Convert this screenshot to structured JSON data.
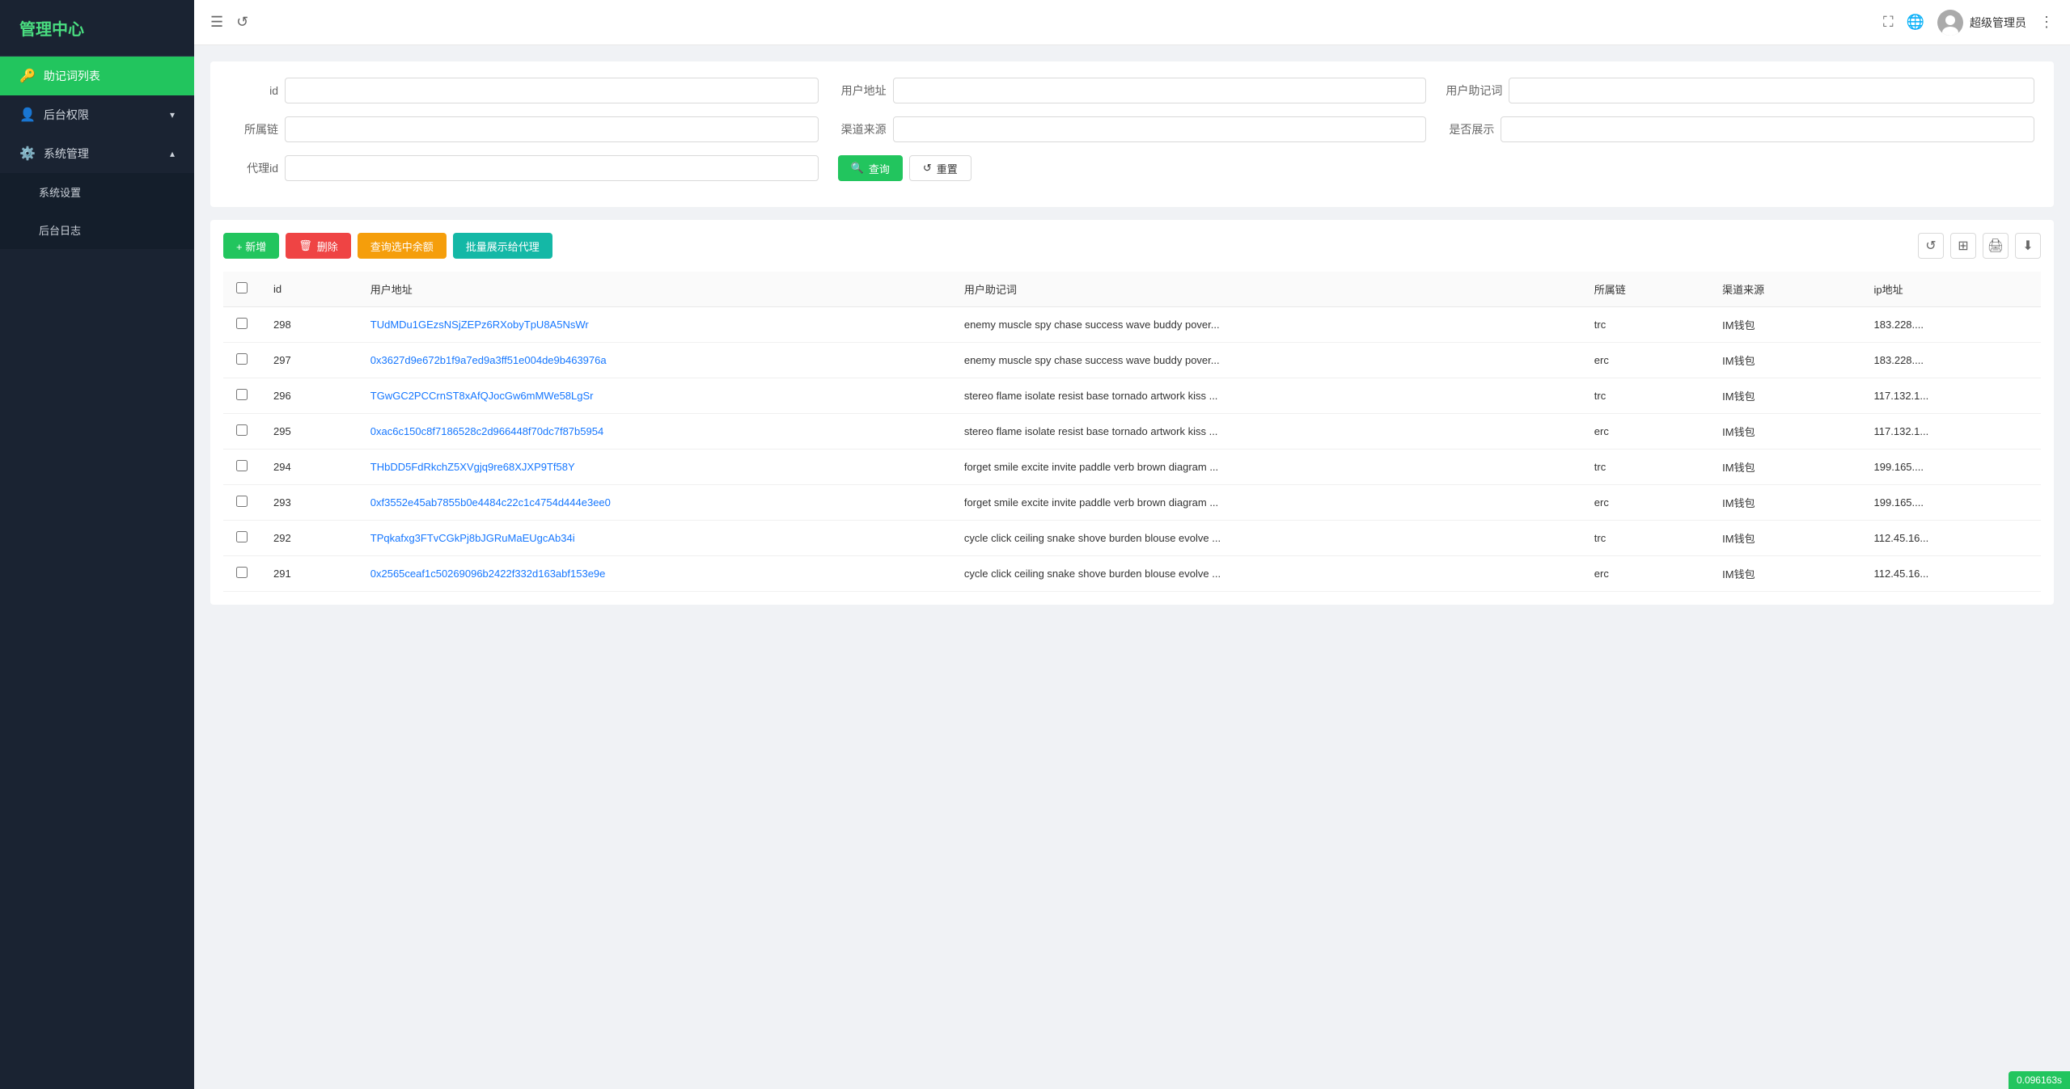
{
  "sidebar": {
    "logo": "管理中心",
    "items": [
      {
        "id": "mnemonic-list",
        "icon": "🔑",
        "label": "助记词列表",
        "active": true
      },
      {
        "id": "backend-permissions",
        "icon": "👤",
        "label": "后台权限",
        "hasArrow": true,
        "expanded": false
      },
      {
        "id": "system-management",
        "icon": "⚙️",
        "label": "系统管理",
        "hasArrow": true,
        "expanded": true
      }
    ],
    "submenu": [
      {
        "id": "system-settings",
        "label": "系统设置"
      },
      {
        "id": "backend-log",
        "label": "后台日志"
      }
    ]
  },
  "header": {
    "username": "超级管理员",
    "more_icon": "⋮"
  },
  "filter": {
    "fields": [
      {
        "id": "id",
        "label": "id",
        "placeholder": ""
      },
      {
        "id": "user-address",
        "label": "用户地址",
        "placeholder": ""
      },
      {
        "id": "user-mnemonic",
        "label": "用户助记词",
        "placeholder": ""
      },
      {
        "id": "chain",
        "label": "所属链",
        "placeholder": ""
      },
      {
        "id": "channel-source",
        "label": "渠道来源",
        "placeholder": ""
      },
      {
        "id": "show-status",
        "label": "是否展示",
        "placeholder": ""
      },
      {
        "id": "agent-id",
        "label": "代理id",
        "placeholder": ""
      }
    ],
    "search_btn": "查询",
    "reset_btn": "重置"
  },
  "toolbar": {
    "add_btn": "+ 新增",
    "delete_btn": "删除",
    "query_balance_btn": "查询选中余额",
    "batch_show_btn": "批量展示给代理"
  },
  "table": {
    "columns": [
      {
        "id": "checkbox",
        "label": ""
      },
      {
        "id": "id",
        "label": "id"
      },
      {
        "id": "user-address",
        "label": "用户地址"
      },
      {
        "id": "user-mnemonic",
        "label": "用户助记词"
      },
      {
        "id": "chain",
        "label": "所属链"
      },
      {
        "id": "channel-source",
        "label": "渠道来源"
      },
      {
        "id": "ip",
        "label": "ip地址"
      }
    ],
    "rows": [
      {
        "id": "298",
        "user_address": "TUdMDu1GEzsNSjZEPz6RXobyTpU8A5NsWr",
        "user_address_link": true,
        "user_mnemonic": "enemy muscle spy chase success wave buddy pover...",
        "chain": "trc",
        "channel": "IM钱包",
        "ip": "183.228...."
      },
      {
        "id": "297",
        "user_address": "0x3627d9e672b1f9a7ed9a3ff51e004de9b463976a",
        "user_address_link": true,
        "user_mnemonic": "enemy muscle spy chase success wave buddy pover...",
        "chain": "erc",
        "channel": "IM钱包",
        "ip": "183.228...."
      },
      {
        "id": "296",
        "user_address": "TGwGC2PCCrnST8xAfQJocGw6mMWe58LgSr",
        "user_address_link": true,
        "user_mnemonic": "stereo flame isolate resist base tornado artwork kiss ...",
        "chain": "trc",
        "channel": "IM钱包",
        "ip": "117.132.1..."
      },
      {
        "id": "295",
        "user_address": "0xac6c150c8f7186528c2d966448f70dc7f87b5954",
        "user_address_link": true,
        "user_mnemonic": "stereo flame isolate resist base tornado artwork kiss ...",
        "chain": "erc",
        "channel": "IM钱包",
        "ip": "117.132.1..."
      },
      {
        "id": "294",
        "user_address": "THbDD5FdRkchZ5XVgjq9re68XJXP9Tf58Y",
        "user_address_link": true,
        "user_mnemonic": "forget smile excite invite paddle verb brown diagram ...",
        "chain": "trc",
        "channel": "IM钱包",
        "ip": "199.165...."
      },
      {
        "id": "293",
        "user_address": "0xf3552e45ab7855b0e4484c22c1c4754d444e3ee0",
        "user_address_link": true,
        "user_mnemonic": "forget smile excite invite paddle verb brown diagram ...",
        "chain": "erc",
        "channel": "IM钱包",
        "ip": "199.165...."
      },
      {
        "id": "292",
        "user_address": "TPqkafxg3FTvCGkPj8bJGRuMaEUgcAb34i",
        "user_address_link": true,
        "user_mnemonic": "cycle click ceiling snake shove burden blouse evolve ...",
        "chain": "trc",
        "channel": "IM钱包",
        "ip": "112.45.16..."
      },
      {
        "id": "291",
        "user_address": "0x2565ceaf1c50269096b2422f332d163abf153e9e",
        "user_address_link": true,
        "user_mnemonic": "cycle click ceiling snake shove burden blouse evolve ...",
        "chain": "erc",
        "channel": "IM钱包",
        "ip": "112.45.16..."
      }
    ]
  },
  "badge": {
    "value": "0.096163s"
  }
}
